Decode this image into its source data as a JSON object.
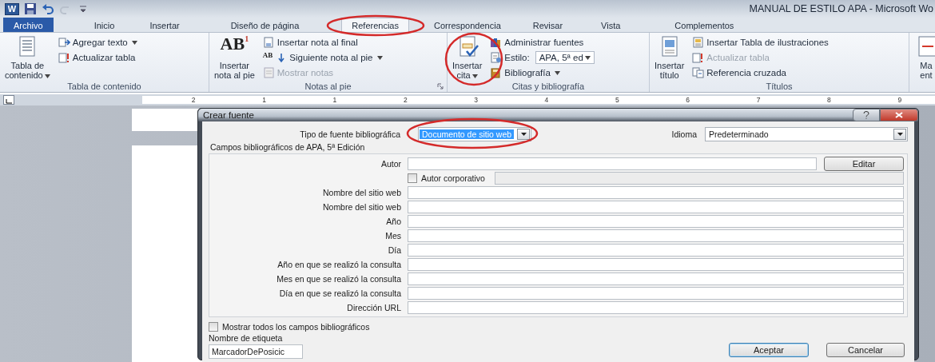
{
  "window": {
    "logo": "W",
    "title": "MANUAL DE ESTILO APA  -  Microsoft Wo"
  },
  "tabs": [
    {
      "label": "Archivo",
      "kind": "file",
      "selected": false
    },
    {
      "label": "Inicio",
      "kind": "tab",
      "selected": false
    },
    {
      "label": "Insertar",
      "kind": "tab",
      "selected": false
    },
    {
      "label": "Diseño de página",
      "kind": "tab",
      "selected": false
    },
    {
      "label": "Referencias",
      "kind": "tab",
      "selected": true
    },
    {
      "label": "Correspondencia",
      "kind": "tab",
      "selected": false
    },
    {
      "label": "Revisar",
      "kind": "tab",
      "selected": false
    },
    {
      "label": "Vista",
      "kind": "tab",
      "selected": false
    },
    {
      "label": "Complementos",
      "kind": "tab",
      "selected": false
    }
  ],
  "ribbon": {
    "groups": [
      {
        "caption": "Tabla de contenido",
        "launcher": false,
        "big": {
          "label": "Tabla de\ncontenido",
          "menu": true
        },
        "items": [
          {
            "label": "Agregar texto",
            "menu": true,
            "disabled": false
          },
          {
            "label": "Actualizar tabla",
            "menu": false,
            "disabled": false
          }
        ]
      },
      {
        "caption": "Notas al pie",
        "launcher": true,
        "big": {
          "label": "Insertar\nnota al pie",
          "menu": false,
          "icon_text": "AB",
          "icon_sup": "1"
        },
        "items": [
          {
            "label": "Insertar nota al final",
            "menu": false,
            "disabled": false
          },
          {
            "label": "Siguiente nota al pie",
            "menu": true,
            "disabled": false,
            "icon_text": "AB"
          },
          {
            "label": "Mostrar notas",
            "menu": false,
            "disabled": true
          }
        ]
      },
      {
        "caption": "Citas y bibliografía",
        "launcher": false,
        "big": {
          "label": "Insertar\ncita",
          "menu": true
        },
        "items": [
          {
            "label": "Administrar fuentes",
            "menu": false,
            "disabled": false
          },
          {
            "label": "Estilo:",
            "menu": false,
            "disabled": false,
            "select": "APA, 5ª ed"
          },
          {
            "label": "Bibliografía",
            "menu": true,
            "disabled": false
          }
        ]
      },
      {
        "caption": "Títulos",
        "launcher": false,
        "big": {
          "label": "Insertar\ntítulo",
          "menu": false
        },
        "items": [
          {
            "label": "Insertar Tabla de ilustraciones",
            "menu": false,
            "disabled": false
          },
          {
            "label": "Actualizar tabla",
            "menu": false,
            "disabled": true
          },
          {
            "label": "Referencia cruzada",
            "menu": false,
            "disabled": false
          }
        ]
      },
      {
        "big": {
          "label": "Ma\nent",
          "menu": false
        }
      }
    ]
  },
  "ruler": {
    "numbers": [
      "2",
      "1",
      "1",
      "2",
      "3",
      "4",
      "5",
      "6",
      "7",
      "8",
      "9"
    ]
  },
  "dialog": {
    "title": "Crear fuente",
    "source_type": {
      "label": "Tipo de fuente bibliográfica",
      "value": "Documento de sitio web"
    },
    "language": {
      "label": "Idioma",
      "value": "Predeterminado"
    },
    "section_label": "Campos bibliográficos de APA, 5ª Edición",
    "fields": [
      {
        "kind": "button_text",
        "label": "Autor",
        "button": "Editar"
      },
      {
        "kind": "checkbox",
        "label": "Autor corporativo",
        "checked": false
      },
      {
        "kind": "text",
        "label": "Nombre del sitio web"
      },
      {
        "kind": "text",
        "label": "Nombre del sitio web"
      },
      {
        "kind": "text",
        "label": "Año"
      },
      {
        "kind": "text",
        "label": "Mes"
      },
      {
        "kind": "text",
        "label": "Día"
      },
      {
        "kind": "text",
        "label": "Año en que se realizó la consulta"
      },
      {
        "kind": "text",
        "label": "Mes en que se realizó la consulta"
      },
      {
        "kind": "text",
        "label": "Día en que se realizó la consulta"
      },
      {
        "kind": "text",
        "label": "Dirección URL"
      }
    ],
    "show_all": {
      "label": "Mostrar todos los campos bibliográficos",
      "checked": false
    },
    "tag": {
      "label": "Nombre de etiqueta",
      "value": "MarcadorDePosicic"
    },
    "buttons": [
      {
        "label": "Aceptar",
        "kind": "default"
      },
      {
        "label": "Cancelar",
        "kind": "normal"
      }
    ]
  },
  "annotations": [
    {
      "kind": "circle",
      "color": "#d42a2a"
    },
    {
      "kind": "circle",
      "color": "#d42a2a"
    },
    {
      "kind": "circle",
      "color": "#d42a2a"
    }
  ]
}
